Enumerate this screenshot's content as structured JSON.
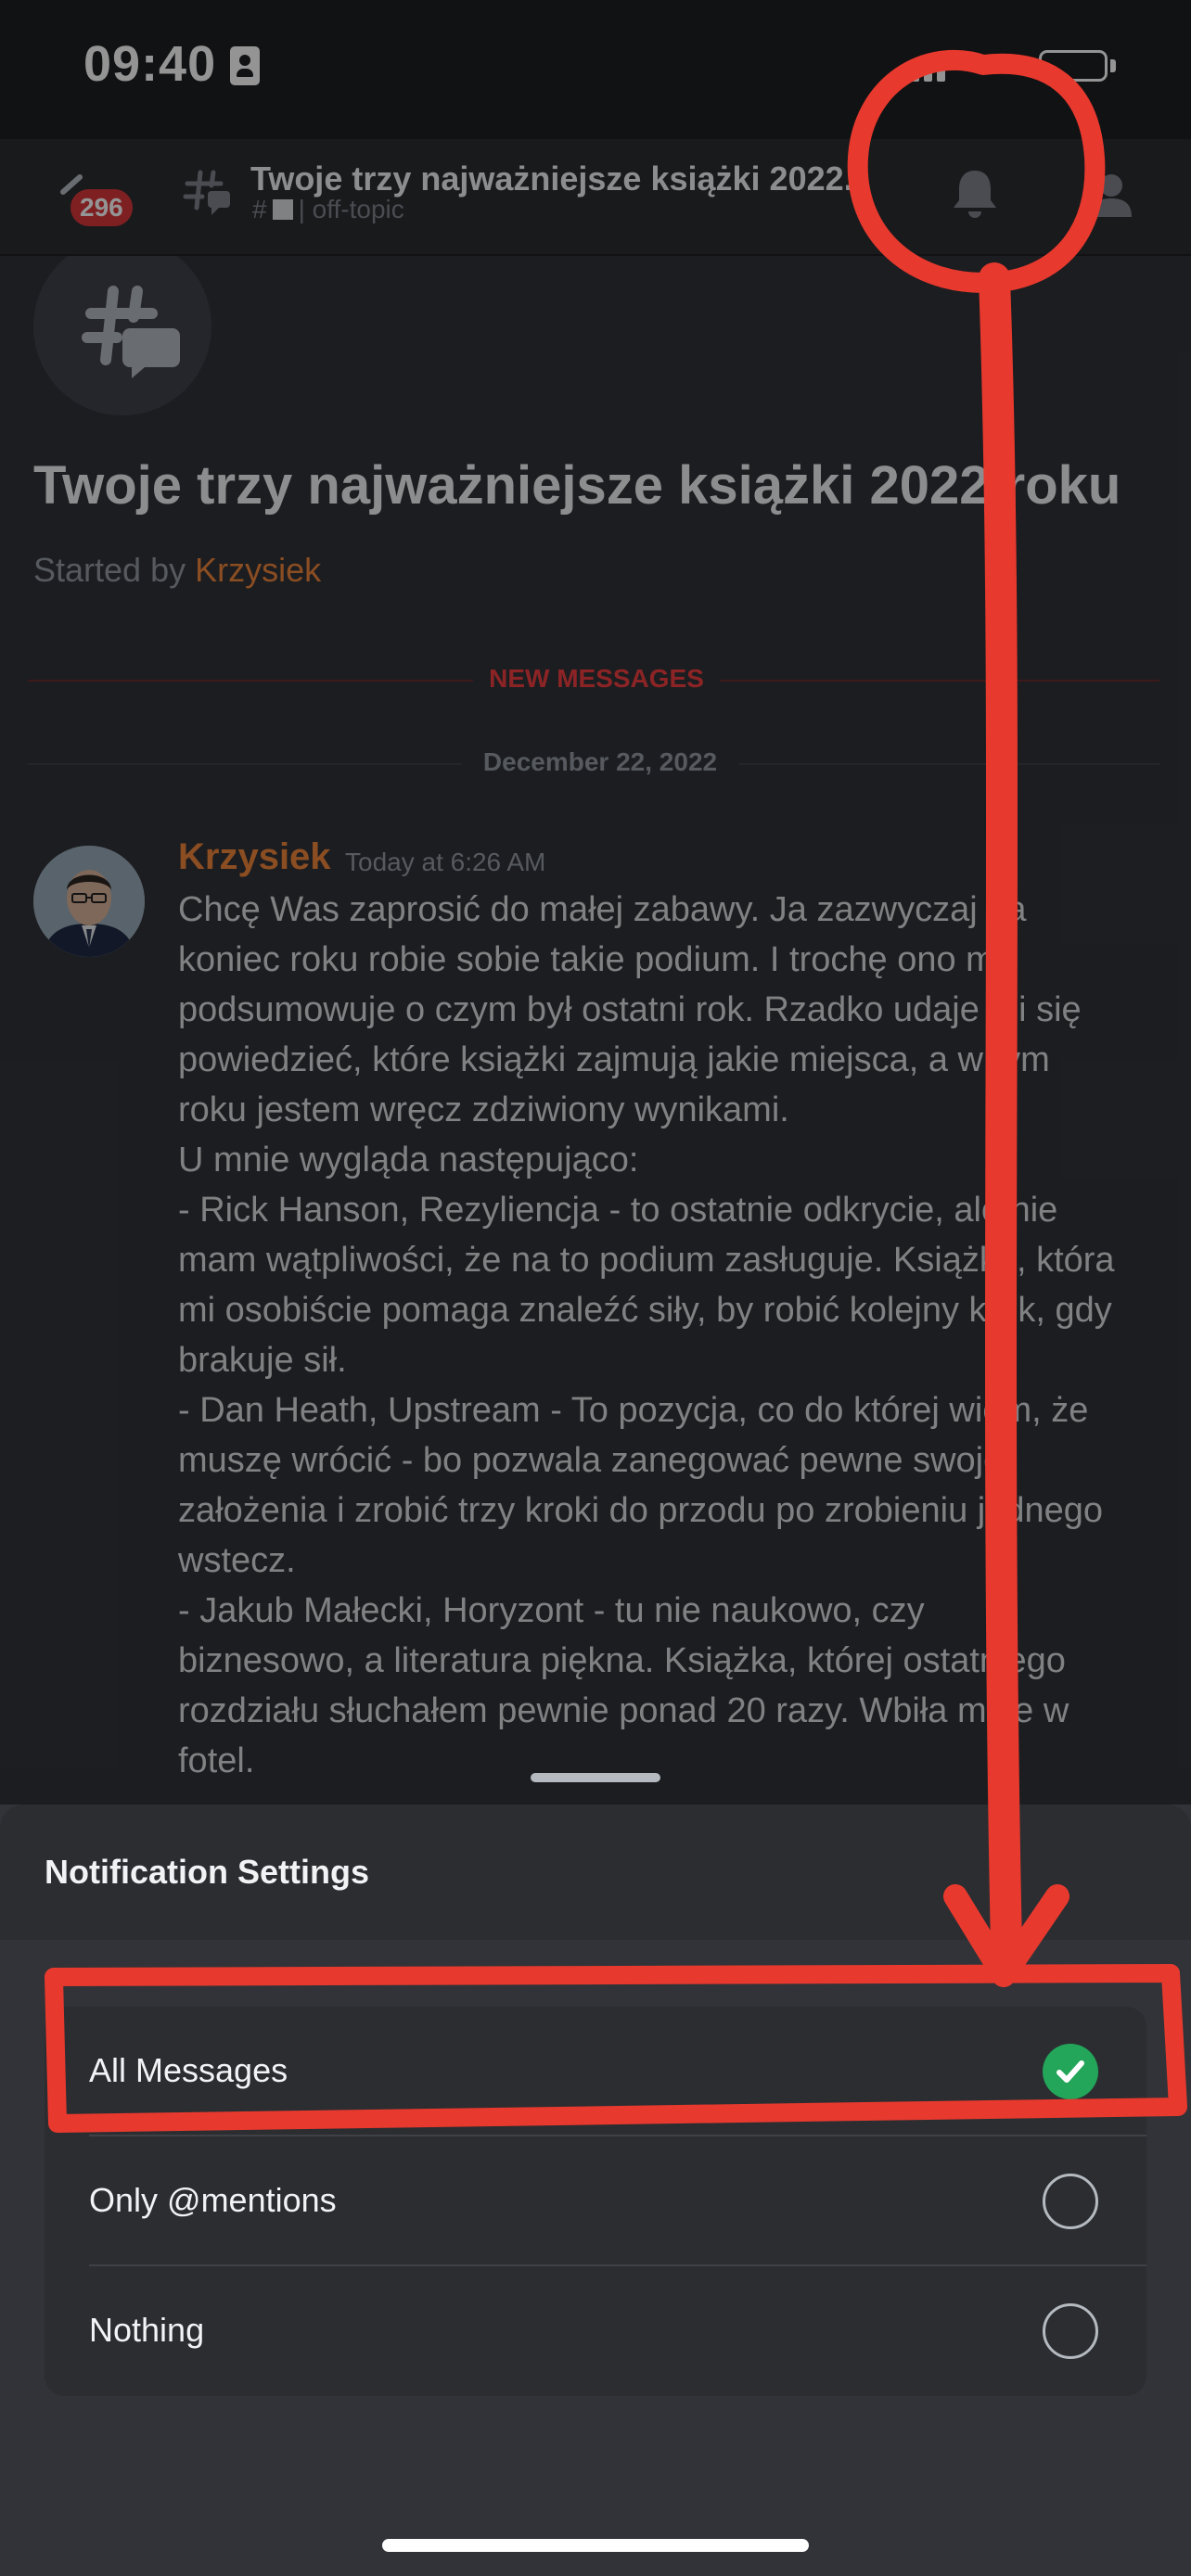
{
  "status_bar": {
    "time": "09:40"
  },
  "header": {
    "unread_count": "296",
    "title": "Twoje trzy najważniejsze książki 2022...",
    "channel_hash": "#",
    "channel_sep": "|",
    "channel_name": "off-topic"
  },
  "thread": {
    "title": "Twoje trzy najważniejsze książki 2022 roku",
    "started_by_label": "Started by",
    "started_by_author": "Krzysiek",
    "new_messages_label": "NEW MESSAGES",
    "date_separator": "December 22, 2022"
  },
  "message": {
    "author": "Krzysiek",
    "timestamp": "Today at 6:26 AM",
    "body": "Chcę Was zaprosić do małej zabawy. Ja zazwyczaj na\nkoniec roku robie sobie takie podium. I trochę ono mi\npodsumowuje o czym był ostatni rok. Rzadko udaje mi się\npowiedzieć, które książki zajmują jakie miejsca, a w tym\nroku jestem wręcz zdziwiony wynikami.\nU mnie wygląda następująco:\n- Rick Hanson, Rezyliencja - to ostatnie odkrycie, ale nie\nmam wątpliwości, że na to podium zasługuje. Książka, która\nmi osobiście pomaga znaleźć siły, by robić kolejny krok, gdy\nbrakuje sił.\n- Dan Heath, Upstream - To pozycja, co do której wiem, że\nmuszę wrócić - bo pozwala zanegować pewne swoje\nzałożenia i zrobić trzy kroki do przodu po zrobieniu jednego\nwstecz.\n- Jakub Małecki, Horyzont - tu nie naukowo, czy\nbiznesowo, a literatura piękna. Książka, której ostatniego\nrozdziału słuchałem pewnie ponad 20 razy. Wbiła mnie w\nfotel."
  },
  "notification_sheet": {
    "title": "Notification Settings",
    "options": [
      {
        "label": "All Messages",
        "selected": true
      },
      {
        "label": "Only @mentions",
        "selected": false
      },
      {
        "label": "Nothing",
        "selected": false
      }
    ]
  },
  "colors": {
    "background": "#313338",
    "author": "#f0863b",
    "new_messages": "#f23f43",
    "selected_check": "#23a55a",
    "annotation": "#e8392e"
  }
}
